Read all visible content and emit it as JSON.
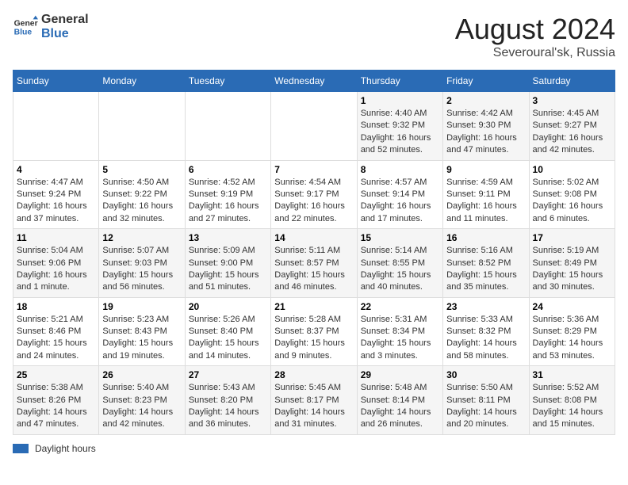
{
  "header": {
    "logo_line1": "General",
    "logo_line2": "Blue",
    "title": "August 2024",
    "subtitle": "Severoural'sk, Russia"
  },
  "days_of_week": [
    "Sunday",
    "Monday",
    "Tuesday",
    "Wednesday",
    "Thursday",
    "Friday",
    "Saturday"
  ],
  "weeks": [
    [
      {
        "day": "",
        "info": ""
      },
      {
        "day": "",
        "info": ""
      },
      {
        "day": "",
        "info": ""
      },
      {
        "day": "",
        "info": ""
      },
      {
        "day": "1",
        "info": "Sunrise: 4:40 AM\nSunset: 9:32 PM\nDaylight: 16 hours and 52 minutes."
      },
      {
        "day": "2",
        "info": "Sunrise: 4:42 AM\nSunset: 9:30 PM\nDaylight: 16 hours and 47 minutes."
      },
      {
        "day": "3",
        "info": "Sunrise: 4:45 AM\nSunset: 9:27 PM\nDaylight: 16 hours and 42 minutes."
      }
    ],
    [
      {
        "day": "4",
        "info": "Sunrise: 4:47 AM\nSunset: 9:24 PM\nDaylight: 16 hours and 37 minutes."
      },
      {
        "day": "5",
        "info": "Sunrise: 4:50 AM\nSunset: 9:22 PM\nDaylight: 16 hours and 32 minutes."
      },
      {
        "day": "6",
        "info": "Sunrise: 4:52 AM\nSunset: 9:19 PM\nDaylight: 16 hours and 27 minutes."
      },
      {
        "day": "7",
        "info": "Sunrise: 4:54 AM\nSunset: 9:17 PM\nDaylight: 16 hours and 22 minutes."
      },
      {
        "day": "8",
        "info": "Sunrise: 4:57 AM\nSunset: 9:14 PM\nDaylight: 16 hours and 17 minutes."
      },
      {
        "day": "9",
        "info": "Sunrise: 4:59 AM\nSunset: 9:11 PM\nDaylight: 16 hours and 11 minutes."
      },
      {
        "day": "10",
        "info": "Sunrise: 5:02 AM\nSunset: 9:08 PM\nDaylight: 16 hours and 6 minutes."
      }
    ],
    [
      {
        "day": "11",
        "info": "Sunrise: 5:04 AM\nSunset: 9:06 PM\nDaylight: 16 hours and 1 minute."
      },
      {
        "day": "12",
        "info": "Sunrise: 5:07 AM\nSunset: 9:03 PM\nDaylight: 15 hours and 56 minutes."
      },
      {
        "day": "13",
        "info": "Sunrise: 5:09 AM\nSunset: 9:00 PM\nDaylight: 15 hours and 51 minutes."
      },
      {
        "day": "14",
        "info": "Sunrise: 5:11 AM\nSunset: 8:57 PM\nDaylight: 15 hours and 46 minutes."
      },
      {
        "day": "15",
        "info": "Sunrise: 5:14 AM\nSunset: 8:55 PM\nDaylight: 15 hours and 40 minutes."
      },
      {
        "day": "16",
        "info": "Sunrise: 5:16 AM\nSunset: 8:52 PM\nDaylight: 15 hours and 35 minutes."
      },
      {
        "day": "17",
        "info": "Sunrise: 5:19 AM\nSunset: 8:49 PM\nDaylight: 15 hours and 30 minutes."
      }
    ],
    [
      {
        "day": "18",
        "info": "Sunrise: 5:21 AM\nSunset: 8:46 PM\nDaylight: 15 hours and 24 minutes."
      },
      {
        "day": "19",
        "info": "Sunrise: 5:23 AM\nSunset: 8:43 PM\nDaylight: 15 hours and 19 minutes."
      },
      {
        "day": "20",
        "info": "Sunrise: 5:26 AM\nSunset: 8:40 PM\nDaylight: 15 hours and 14 minutes."
      },
      {
        "day": "21",
        "info": "Sunrise: 5:28 AM\nSunset: 8:37 PM\nDaylight: 15 hours and 9 minutes."
      },
      {
        "day": "22",
        "info": "Sunrise: 5:31 AM\nSunset: 8:34 PM\nDaylight: 15 hours and 3 minutes."
      },
      {
        "day": "23",
        "info": "Sunrise: 5:33 AM\nSunset: 8:32 PM\nDaylight: 14 hours and 58 minutes."
      },
      {
        "day": "24",
        "info": "Sunrise: 5:36 AM\nSunset: 8:29 PM\nDaylight: 14 hours and 53 minutes."
      }
    ],
    [
      {
        "day": "25",
        "info": "Sunrise: 5:38 AM\nSunset: 8:26 PM\nDaylight: 14 hours and 47 minutes."
      },
      {
        "day": "26",
        "info": "Sunrise: 5:40 AM\nSunset: 8:23 PM\nDaylight: 14 hours and 42 minutes."
      },
      {
        "day": "27",
        "info": "Sunrise: 5:43 AM\nSunset: 8:20 PM\nDaylight: 14 hours and 36 minutes."
      },
      {
        "day": "28",
        "info": "Sunrise: 5:45 AM\nSunset: 8:17 PM\nDaylight: 14 hours and 31 minutes."
      },
      {
        "day": "29",
        "info": "Sunrise: 5:48 AM\nSunset: 8:14 PM\nDaylight: 14 hours and 26 minutes."
      },
      {
        "day": "30",
        "info": "Sunrise: 5:50 AM\nSunset: 8:11 PM\nDaylight: 14 hours and 20 minutes."
      },
      {
        "day": "31",
        "info": "Sunrise: 5:52 AM\nSunset: 8:08 PM\nDaylight: 14 hours and 15 minutes."
      }
    ]
  ],
  "footer": {
    "swatch_label": "Daylight hours"
  }
}
